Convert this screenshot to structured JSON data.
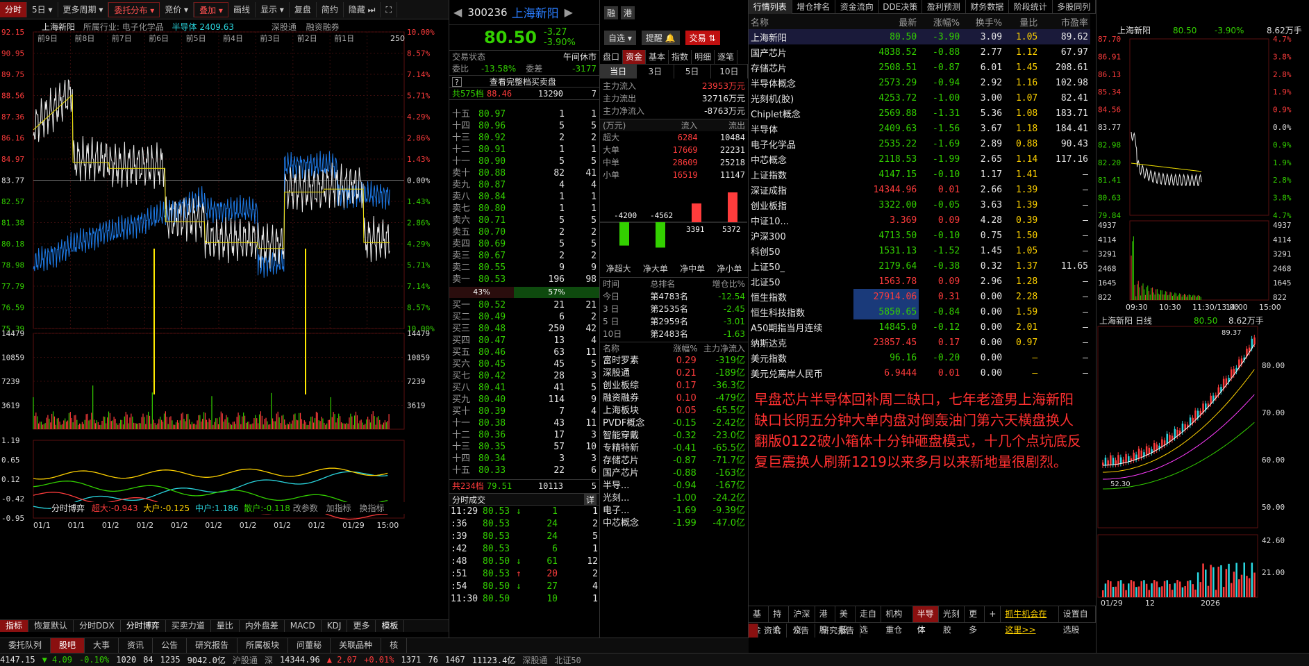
{
  "toolbar": {
    "items": [
      "分时",
      "5日",
      "更多周期",
      "委托分布",
      "竞价",
      "叠加",
      "画线",
      "显示",
      "复盘",
      "简约",
      "隐藏"
    ]
  },
  "chart": {
    "title": "上海新阳",
    "industry": "所属行业: 电子化学品",
    "overlay": "半导体 2409.63",
    "right_labels": [
      "深股通",
      "融资融券"
    ],
    "day_labels": [
      "前9日",
      "前8日",
      "前7日",
      "前6日",
      "前5日",
      "前4日",
      "前3日",
      "前2日",
      "前1日"
    ],
    "price_ticks": [
      "92.15",
      "90.95",
      "89.75",
      "88.56",
      "87.36",
      "86.16",
      "84.97",
      "83.77",
      "82.57",
      "81.38",
      "80.18",
      "78.98",
      "77.79",
      "76.59",
      "75.39"
    ],
    "pct_ticks": [
      "10.00%",
      "8.57%",
      "7.14%",
      "5.71%",
      "4.29%",
      "2.86%",
      "1.43%",
      "0.00%",
      "1.43%",
      "2.86%",
      "4.29%",
      "5.71%",
      "7.14%",
      "8.57%",
      "10.00%"
    ],
    "vol_ticks": [
      "14479",
      "10859",
      "7239",
      "3619"
    ],
    "vol_marker": "250",
    "fund_header": {
      "name": "分时博弈",
      "big": "超大:-0.943",
      "large": "大户:-0.125",
      "mid": "中户:1.186",
      "retail": "散户:-0.118",
      "b1": "改参数",
      "b2": "加指标",
      "b3": "换指标"
    },
    "fund_ticks": [
      "1.19",
      "0.65",
      "0.12",
      "-0.42",
      "-0.95"
    ],
    "x_ticks": [
      "01/1",
      "01/1",
      "01/2",
      "01/2",
      "01/2",
      "01/2",
      "01/2",
      "01/2",
      "01/2",
      "01/29",
      "15:00"
    ],
    "bottom_tabs": [
      "指标",
      "恢复默认",
      "分时DDX",
      "分时博弈",
      "买卖力道",
      "量比",
      "内外盘差",
      "MACD",
      "KDJ",
      "更多",
      "模板"
    ]
  },
  "quote": {
    "code": "300236",
    "name": "上海新阳",
    "price": "80.50",
    "change": "-3.27",
    "pct": "-3.90%",
    "btn1": "融",
    "btn2": "港",
    "select": "自选",
    "remind": "提醒",
    "trade": "交易",
    "status_label": "交易状态",
    "status": "午间休市",
    "ratio_label": "委比",
    "ratio": "-13.58%",
    "diff_label": "委差",
    "diff": "-3177",
    "full_book": "查看完整档买卖盘",
    "ask_total": "共575档",
    "ask_total_px": "88.46",
    "ask_total_vol": "13290",
    "ask_total_n": "7",
    "asks": [
      [
        "十五",
        "80.97",
        "1",
        "1"
      ],
      [
        "十四",
        "80.96",
        "5",
        "5"
      ],
      [
        "十三",
        "80.92",
        "2",
        "2"
      ],
      [
        "十二",
        "80.91",
        "1",
        "1"
      ],
      [
        "十一",
        "80.90",
        "5",
        "5"
      ],
      [
        "卖十",
        "80.88",
        "82",
        "41"
      ],
      [
        "卖九",
        "80.87",
        "4",
        "4"
      ],
      [
        "卖八",
        "80.84",
        "1",
        "1"
      ],
      [
        "卖七",
        "80.80",
        "1",
        "1"
      ],
      [
        "卖六",
        "80.71",
        "5",
        "5"
      ],
      [
        "卖五",
        "80.70",
        "2",
        "2"
      ],
      [
        "卖四",
        "80.69",
        "5",
        "5"
      ],
      [
        "卖三",
        "80.67",
        "2",
        "2"
      ],
      [
        "卖二",
        "80.55",
        "9",
        "9"
      ],
      [
        "卖一",
        "80.53",
        "196",
        "98"
      ]
    ],
    "bar_left": "43%",
    "bar_right": "57%",
    "bar_ratio": 0.43,
    "bids": [
      [
        "买一",
        "80.52",
        "21",
        "21"
      ],
      [
        "买二",
        "80.49",
        "6",
        "2"
      ],
      [
        "买三",
        "80.48",
        "250",
        "42"
      ],
      [
        "买四",
        "80.47",
        "13",
        "4"
      ],
      [
        "买五",
        "80.46",
        "63",
        "11"
      ],
      [
        "买六",
        "80.45",
        "45",
        "5"
      ],
      [
        "买七",
        "80.42",
        "28",
        "3"
      ],
      [
        "买八",
        "80.41",
        "41",
        "5"
      ],
      [
        "买九",
        "80.40",
        "114",
        "9"
      ],
      [
        "买十",
        "80.39",
        "7",
        "4"
      ],
      [
        "十一",
        "80.38",
        "43",
        "11"
      ],
      [
        "十二",
        "80.36",
        "17",
        "3"
      ],
      [
        "十三",
        "80.35",
        "57",
        "10"
      ],
      [
        "十四",
        "80.34",
        "3",
        "3"
      ],
      [
        "十五",
        "80.33",
        "22",
        "6"
      ]
    ],
    "bid_total": "共234档",
    "bid_total_px": "79.51",
    "bid_total_vol": "10113",
    "bid_total_n": "5",
    "trades_title": "分时成交",
    "trades_btn": "详",
    "trades": [
      [
        "11:29",
        "80.53",
        "↓",
        "1",
        "1"
      ],
      [
        ":36",
        "80.53",
        "",
        "24",
        "2"
      ],
      [
        ":39",
        "80.53",
        "",
        "24",
        "5"
      ],
      [
        ":42",
        "80.53",
        "",
        "6",
        "1"
      ],
      [
        ":48",
        "80.50",
        "↓",
        "61",
        "12"
      ],
      [
        ":51",
        "80.53",
        "↑",
        "20",
        "2"
      ],
      [
        ":54",
        "80.50",
        "↓",
        "27",
        "4"
      ],
      [
        "11:30",
        "80.50",
        "",
        "10",
        "1"
      ]
    ]
  },
  "funds": {
    "tabs": [
      "盘口",
      "资金",
      "基本",
      "指数",
      "明细",
      "逐笔"
    ],
    "subtabs": [
      "当日",
      "3日",
      "5日",
      "10日"
    ],
    "main_in": [
      "主力流入",
      "23953万元"
    ],
    "main_out": [
      "主力流出",
      "32716万元"
    ],
    "main_net": [
      "主力净流入",
      "-8763万元"
    ],
    "table_head": [
      "(万元)",
      "流入",
      "流出"
    ],
    "rows": [
      [
        "超大",
        "6284",
        "10484"
      ],
      [
        "大单",
        "17669",
        "22231"
      ],
      [
        "中单",
        "28609",
        "25218"
      ],
      [
        "小单",
        "16519",
        "11147"
      ]
    ],
    "bars": [
      {
        "label": "-4200",
        "v": -4200
      },
      {
        "label": "-4562",
        "v": -4562
      },
      {
        "label": "3391",
        "v": 3391
      },
      {
        "label": "5372",
        "v": 5372
      }
    ],
    "bar_names": [
      "净超大",
      "净大单",
      "净中单",
      "净小单"
    ],
    "rank_head": [
      "时间",
      "总排名",
      "增仓比%"
    ],
    "ranks": [
      [
        "今日",
        "第4783名",
        "-12.54"
      ],
      [
        "3 日",
        "第2535名",
        "-2.45"
      ],
      [
        "5 日",
        "第2959名",
        "-3.01"
      ],
      [
        "10日",
        "第2483名",
        "-1.63"
      ]
    ],
    "sector_head": [
      "名称",
      "涨幅%",
      "主力净流入"
    ],
    "sectors": [
      [
        "富时罗素",
        "0.29",
        "-319亿"
      ],
      [
        "深股通",
        "0.21",
        "-189亿"
      ],
      [
        "创业板综",
        "0.17",
        "-36.3亿"
      ],
      [
        "融资融券",
        "0.10",
        "-479亿"
      ],
      [
        "上海板块",
        "0.05",
        "-65.5亿"
      ],
      [
        "PVDF概念",
        "-0.15",
        "-2.42亿"
      ],
      [
        "智能穿戴",
        "-0.32",
        "-23.0亿"
      ],
      [
        "专精特新",
        "-0.41",
        "-65.5亿"
      ],
      [
        "存储芯片",
        "-0.87",
        "-71.7亿"
      ],
      [
        "国产芯片",
        "-0.88",
        "-163亿"
      ],
      [
        "半导...",
        "-0.94",
        "-167亿"
      ],
      [
        "光刻...",
        "-1.00",
        "-24.2亿"
      ],
      [
        "电子...",
        "-1.69",
        "-9.39亿"
      ],
      [
        "中芯概念",
        "-1.99",
        "-47.0亿"
      ]
    ]
  },
  "list": {
    "tabs": [
      "行情列表",
      "增仓排名",
      "资金流向",
      "DDE决策",
      "盈利预测",
      "财务数据",
      "阶段统计",
      "多股同列"
    ],
    "head": [
      "名称",
      "最新",
      "涨幅%",
      "换手%",
      "量比",
      "市盈率"
    ],
    "rows": [
      [
        "上海新阳",
        "80.50",
        "-3.90",
        "3.09",
        "1.05",
        "89.62"
      ],
      [
        "国产芯片",
        "4838.52",
        "-0.88",
        "2.77",
        "1.12",
        "67.97"
      ],
      [
        "存储芯片",
        "2508.51",
        "-0.87",
        "6.01",
        "1.45",
        "208.61"
      ],
      [
        "半导体概念",
        "2573.29",
        "-0.94",
        "2.92",
        "1.16",
        "102.98"
      ],
      [
        "光刻机(胶)",
        "4253.72",
        "-1.00",
        "3.00",
        "1.07",
        "82.41"
      ],
      [
        "Chiplet概念",
        "2569.88",
        "-1.31",
        "5.36",
        "1.08",
        "183.71"
      ],
      [
        "半导体",
        "2409.63",
        "-1.56",
        "3.67",
        "1.18",
        "184.41"
      ],
      [
        "电子化学品",
        "2535.22",
        "-1.69",
        "2.89",
        "0.88",
        "90.43"
      ],
      [
        "中芯概念",
        "2118.53",
        "-1.99",
        "2.65",
        "1.14",
        "117.16"
      ],
      [
        "上证指数",
        "4147.15",
        "-0.10",
        "1.17",
        "1.41",
        "—"
      ],
      [
        "深证成指",
        "14344.96",
        "0.01",
        "2.66",
        "1.39",
        "—"
      ],
      [
        "创业板指",
        "3322.00",
        "-0.05",
        "3.63",
        "1.39",
        "—"
      ],
      [
        "中证10...",
        "3.369",
        "0.09",
        "4.28",
        "0.39",
        "—"
      ],
      [
        "沪深300",
        "4713.50",
        "-0.10",
        "0.75",
        "1.50",
        "—"
      ],
      [
        "科创50",
        "1531.13",
        "-1.52",
        "1.45",
        "1.05",
        "—"
      ],
      [
        "上证50_",
        "2179.64",
        "-0.38",
        "0.32",
        "1.37",
        "11.65"
      ],
      [
        "北证50",
        "1563.78",
        "0.09",
        "2.96",
        "1.28",
        "—"
      ],
      [
        "恒生指数",
        "27914.06",
        "0.31",
        "0.00",
        "2.28",
        "—"
      ],
      [
        "恒生科技指数",
        "5850.65",
        "-0.84",
        "0.00",
        "1.59",
        "—"
      ],
      [
        "A50期指当月连续",
        "14845.0",
        "-0.12",
        "0.00",
        "2.01",
        "—"
      ],
      [
        "纳斯达克",
        "23857.45",
        "0.17",
        "0.00",
        "0.97",
        "—"
      ],
      [
        "美元指数",
        "96.16",
        "-0.20",
        "0.00",
        "—",
        "—"
      ],
      [
        "美元兑离岸人民币",
        "6.9444",
        "0.01",
        "0.00",
        "—",
        "—"
      ]
    ],
    "note": "早盘芯片半导体回补周二缺口，七年老渣男上海新阳缺口长阴五分钟大单内盘对倒轰油门第六天横盘换人翻版0122破小箱体十分钟砸盘模式，十几个点坑底反复巨震换人刷新1219以来多月以来新地量很剧烈。",
    "bottom_tabs": [
      "基金",
      "持仓",
      "沪深京",
      "港股",
      "美股",
      "走自选",
      "机构重仓",
      "半导体",
      "光刻胶",
      "更多",
      "+",
      "抓牛机会在这里>>",
      "设置自选股"
    ]
  },
  "mini": {
    "name": "上海新阳",
    "price": "80.50",
    "pct": "-3.90%",
    "vol": "8.62万手",
    "ticks": [
      "87.70",
      "86.91",
      "86.13",
      "85.34",
      "84.56",
      "83.77",
      "82.98",
      "82.20",
      "81.41",
      "80.63",
      "79.84"
    ],
    "pcts": [
      "4.7%",
      "3.8%",
      "2.8%",
      "1.9%",
      "0.9%",
      "0.0%",
      "0.9%",
      "1.9%",
      "2.8%",
      "3.8%",
      "4.7%"
    ],
    "vticks": [
      "4937",
      "4114",
      "3291",
      "2468",
      "1645",
      "822"
    ],
    "times": [
      "09:30",
      "10:30",
      "11:30/13:00",
      "14:00",
      "15:00"
    ],
    "daily_name": "上海新阳 日线",
    "daily_price": "80.50",
    "daily_vol": "8.62万手",
    "hi": "89.37",
    "lo": "52.30",
    "dticks": [
      "80.00",
      "70.00",
      "60.00",
      "50.00"
    ],
    "dvticks": [
      "42.60",
      "21.00"
    ],
    "dx": [
      "01/29",
      "12",
      "2026"
    ]
  },
  "bottombar": {
    "tabs": [
      "委托队列",
      "股吧",
      "大事",
      "资讯",
      "公告",
      "研究报告",
      "所属板块",
      "问董秘",
      "关联品种",
      "核"
    ],
    "right_tabs": [
      "资讯",
      "公告",
      "研究报告"
    ]
  },
  "statusbar": [
    "4147.15",
    "▼ 4.09",
    "-0.10%",
    "1020",
    "84",
    "1235",
    "9042.0亿",
    "沪股通",
    "深",
    "14344.96",
    "▲ 2.07",
    "+0.01%",
    "1371",
    "76",
    "1467",
    "11123.4亿",
    "深股通",
    "北证50"
  ]
}
